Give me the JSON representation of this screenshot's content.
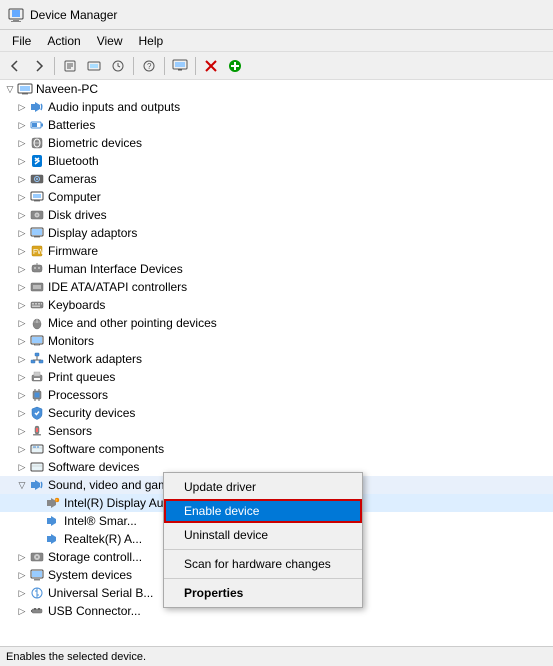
{
  "titleBar": {
    "title": "Device Manager"
  },
  "menuBar": {
    "items": [
      "File",
      "Action",
      "View",
      "Help"
    ]
  },
  "statusBar": {
    "text": "Enables the selected device."
  },
  "tree": {
    "rootLabel": "Naveen-PC",
    "items": [
      {
        "label": "Audio inputs and outputs",
        "indent": 1,
        "arrow": "▷",
        "hasArrow": true
      },
      {
        "label": "Batteries",
        "indent": 1,
        "arrow": "▷",
        "hasArrow": true
      },
      {
        "label": "Biometric devices",
        "indent": 1,
        "arrow": "▷",
        "hasArrow": true
      },
      {
        "label": "Bluetooth",
        "indent": 1,
        "arrow": "▷",
        "hasArrow": true
      },
      {
        "label": "Cameras",
        "indent": 1,
        "arrow": "▷",
        "hasArrow": true
      },
      {
        "label": "Computer",
        "indent": 1,
        "arrow": "▷",
        "hasArrow": true
      },
      {
        "label": "Disk drives",
        "indent": 1,
        "arrow": "▷",
        "hasArrow": true
      },
      {
        "label": "Display adaptors",
        "indent": 1,
        "arrow": "▷",
        "hasArrow": true
      },
      {
        "label": "Firmware",
        "indent": 1,
        "arrow": "▷",
        "hasArrow": true
      },
      {
        "label": "Human Interface Devices",
        "indent": 1,
        "arrow": "▷",
        "hasArrow": true
      },
      {
        "label": "IDE ATA/ATAPI controllers",
        "indent": 1,
        "arrow": "▷",
        "hasArrow": true
      },
      {
        "label": "Keyboards",
        "indent": 1,
        "arrow": "▷",
        "hasArrow": true
      },
      {
        "label": "Mice and other pointing devices",
        "indent": 1,
        "arrow": "▷",
        "hasArrow": true
      },
      {
        "label": "Monitors",
        "indent": 1,
        "arrow": "▷",
        "hasArrow": true
      },
      {
        "label": "Network adapters",
        "indent": 1,
        "arrow": "▷",
        "hasArrow": true
      },
      {
        "label": "Print queues",
        "indent": 1,
        "arrow": "▷",
        "hasArrow": true
      },
      {
        "label": "Processors",
        "indent": 1,
        "arrow": "▷",
        "hasArrow": true
      },
      {
        "label": "Security devices",
        "indent": 1,
        "arrow": "▷",
        "hasArrow": true
      },
      {
        "label": "Sensors",
        "indent": 1,
        "arrow": "▷",
        "hasArrow": true
      },
      {
        "label": "Software components",
        "indent": 1,
        "arrow": "▷",
        "hasArrow": true
      },
      {
        "label": "Software devices",
        "indent": 1,
        "arrow": "▷",
        "hasArrow": true
      },
      {
        "label": "Sound, video and game controllers",
        "indent": 1,
        "arrow": "▽",
        "hasArrow": true,
        "expanded": true
      },
      {
        "label": "Intel(R) Display Audio",
        "indent": 2,
        "hasArrow": false,
        "contextMenu": true
      },
      {
        "label": "Intel® Smar...",
        "indent": 2,
        "hasArrow": false
      },
      {
        "label": "Realtek(R) A...",
        "indent": 2,
        "hasArrow": false
      },
      {
        "label": "Storage controll...",
        "indent": 1,
        "arrow": "▷",
        "hasArrow": true
      },
      {
        "label": "System devices",
        "indent": 1,
        "arrow": "▷",
        "hasArrow": true
      },
      {
        "label": "Universal Serial B...",
        "indent": 1,
        "arrow": "▷",
        "hasArrow": true
      },
      {
        "label": "USB Connector...",
        "indent": 1,
        "arrow": "▷",
        "hasArrow": true
      }
    ]
  },
  "contextMenu": {
    "items": [
      {
        "label": "Update driver",
        "type": "normal"
      },
      {
        "label": "Enable device",
        "type": "highlighted"
      },
      {
        "label": "Uninstall device",
        "type": "normal"
      },
      {
        "label": "Scan for hardware changes",
        "type": "normal"
      },
      {
        "label": "Properties",
        "type": "bold"
      }
    ]
  }
}
